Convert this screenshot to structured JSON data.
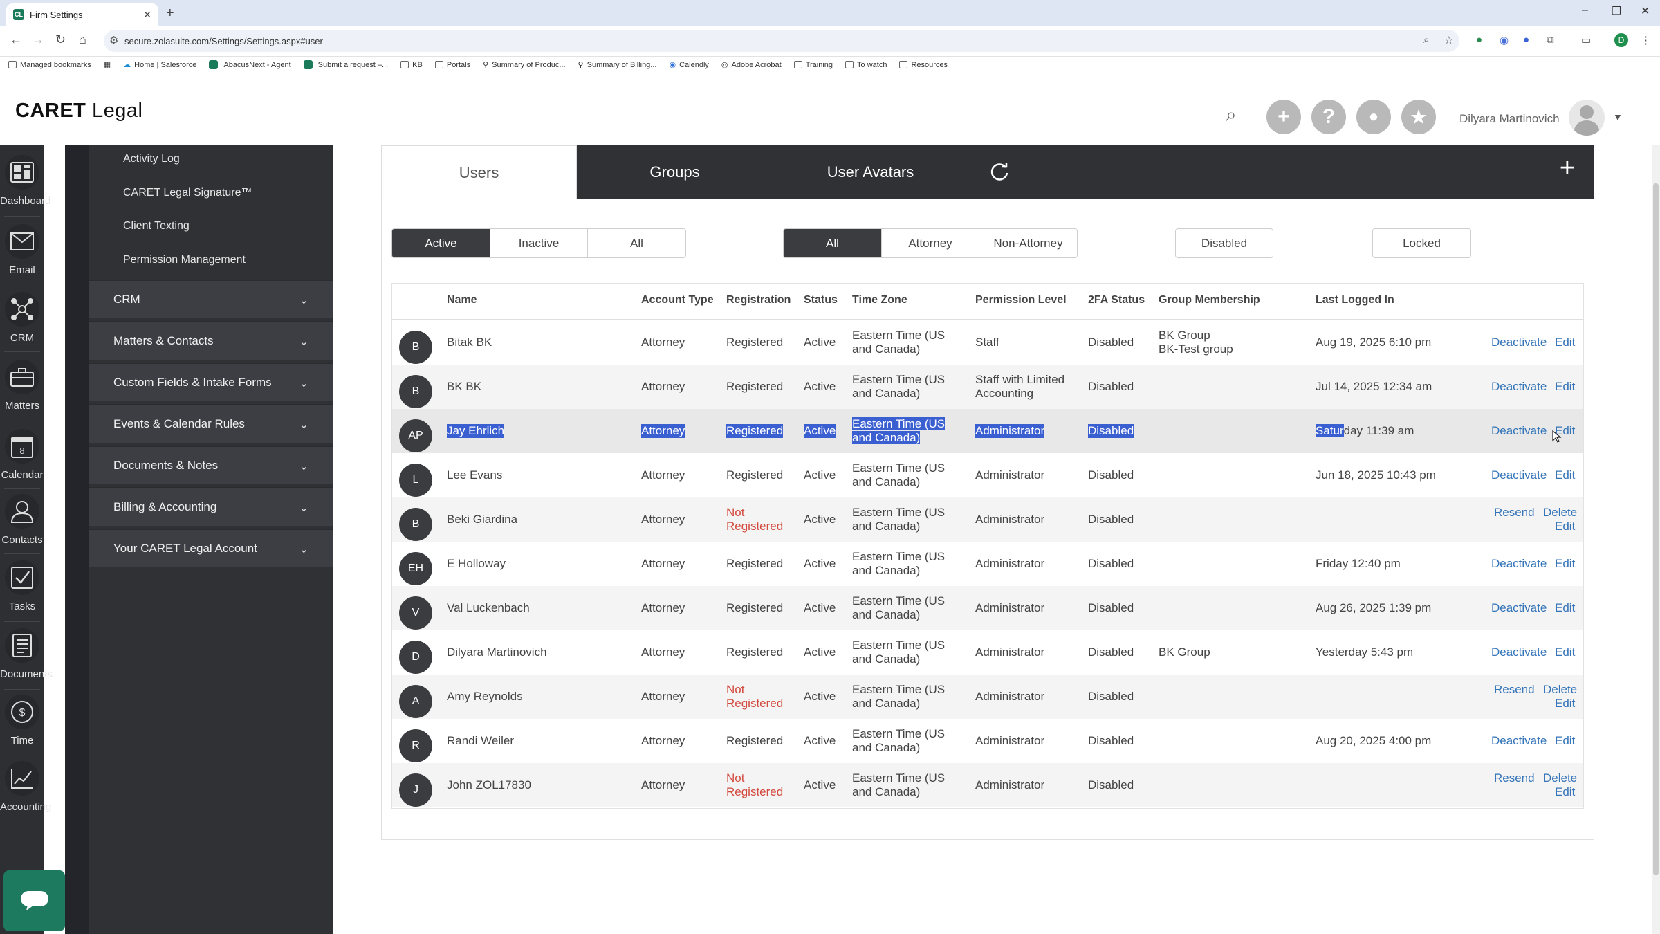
{
  "browser": {
    "tab_title": "Firm Settings",
    "favicon_text": "CL",
    "url": "secure.zolasuite.com/Settings/Settings.aspx#user",
    "profile_initial": "D",
    "bookmarks": [
      "Managed bookmarks",
      "Home | Salesforce",
      "AbacusNext - Agent",
      "Submit a request –...",
      "KB",
      "Portals",
      "Summary of Produc...",
      "Summary of Billing...",
      "Calendly",
      "Adobe Acrobat",
      "Training",
      "To watch",
      "Resources"
    ]
  },
  "header": {
    "logo_prefix": "CARET",
    "logo_suffix": " Legal",
    "user_name": "Dilyara Martinovich"
  },
  "rail": {
    "items": [
      "Dashboard",
      "Email",
      "CRM",
      "Matters",
      "Calendar",
      "Contacts",
      "Tasks",
      "Documents",
      "Time",
      "Accounting"
    ],
    "calendar_day": "8"
  },
  "settings_nav": {
    "sub_items": [
      "Activity Log",
      "CARET Legal Signature™",
      "Client Texting",
      "Permission Management"
    ],
    "sections": [
      "CRM",
      "Matters & Contacts",
      "Custom Fields & Intake Forms",
      "Events & Calendar Rules",
      "Documents & Notes",
      "Billing & Accounting",
      "Your CARET Legal Account"
    ]
  },
  "tabs": {
    "users": "Users",
    "groups": "Groups",
    "avatars": "User Avatars"
  },
  "filters": {
    "status": [
      "Active",
      "Inactive",
      "All"
    ],
    "type": [
      "All",
      "Attorney",
      "Non-Attorney"
    ],
    "disabled": "Disabled",
    "locked": "Locked"
  },
  "table": {
    "columns": [
      "Name",
      "Account Type",
      "Registration",
      "Status",
      "Time Zone",
      "Permission Level",
      "2FA Status",
      "Group Membership",
      "Last Logged In"
    ],
    "rows": [
      {
        "initials": "B",
        "name": "Bitak BK",
        "type": "Attorney",
        "reg": "Registered",
        "status": "Active",
        "tz1": "Eastern Time (US",
        "tz2": "and Canada)",
        "perm1": "Staff",
        "perm2": "",
        "twofa": "Disabled",
        "group1": "BK Group",
        "group2": "BK-Test group",
        "last": "Aug 19, 2025 6:10 pm",
        "act1": "Deactivate",
        "act2": "Edit"
      },
      {
        "initials": "B",
        "name": "BK BK",
        "type": "Attorney",
        "reg": "Registered",
        "status": "Active",
        "tz1": "Eastern Time (US",
        "tz2": "and Canada)",
        "perm1": "Staff with Limited",
        "perm2": "Accounting",
        "twofa": "Disabled",
        "group1": "",
        "group2": "",
        "last": "Jul 14, 2025 12:34 am",
        "act1": "Deactivate",
        "act2": "Edit"
      },
      {
        "initials": "AP",
        "name": "Jay Ehrlich",
        "type": "Attorney",
        "reg": "Registered",
        "status": "Active",
        "tz1": "Eastern Time (US",
        "tz2": "and Canada)",
        "perm1": "Administrator",
        "perm2": "",
        "twofa": "Disabled",
        "group1": "",
        "group2": "",
        "last_a": "Satur",
        "last_b": "day 11:39 am",
        "act1": "Deactivate",
        "act2": "Edit"
      },
      {
        "initials": "L",
        "name": "Lee Evans",
        "type": "Attorney",
        "reg": "Registered",
        "status": "Active",
        "tz1": "Eastern Time (US",
        "tz2": "and Canada)",
        "perm1": "Administrator",
        "perm2": "",
        "twofa": "Disabled",
        "group1": "",
        "group2": "",
        "last": "Jun 18, 2025 10:43 pm",
        "act1": "Deactivate",
        "act2": "Edit"
      },
      {
        "initials": "B",
        "name": "Beki Giardina",
        "type": "Attorney",
        "reg1": "Not",
        "reg2": "Registered",
        "status": "Active",
        "tz1": "Eastern Time (US",
        "tz2": "and Canada)",
        "perm1": "Administrator",
        "perm2": "",
        "twofa": "Disabled",
        "group1": "",
        "group2": "",
        "last": "",
        "act1": "Resend",
        "act2": "Delete",
        "act3": "Edit"
      },
      {
        "initials": "EH",
        "name": "E Holloway",
        "type": "Attorney",
        "reg": "Registered",
        "status": "Active",
        "tz1": "Eastern Time (US",
        "tz2": "and Canada)",
        "perm1": "Administrator",
        "perm2": "",
        "twofa": "Disabled",
        "group1": "",
        "group2": "",
        "last": "Friday 12:40 pm",
        "act1": "Deactivate",
        "act2": "Edit"
      },
      {
        "initials": "V",
        "name": "Val Luckenbach",
        "type": "Attorney",
        "reg": "Registered",
        "status": "Active",
        "tz1": "Eastern Time (US",
        "tz2": "and Canada)",
        "perm1": "Administrator",
        "perm2": "",
        "twofa": "Disabled",
        "group1": "",
        "group2": "",
        "last": "Aug 26, 2025 1:39 pm",
        "act1": "Deactivate",
        "act2": "Edit"
      },
      {
        "initials": "D",
        "name": "Dilyara Martinovich",
        "type": "Attorney",
        "reg": "Registered",
        "status": "Active",
        "tz1": "Eastern Time (US",
        "tz2": "and Canada)",
        "perm1": "Administrator",
        "perm2": "",
        "twofa": "Disabled",
        "group1": "BK Group",
        "group2": "",
        "last": "Yesterday 5:43 pm",
        "act1": "Deactivate",
        "act2": "Edit"
      },
      {
        "initials": "A",
        "name": "Amy Reynolds",
        "type": "Attorney",
        "reg1": "Not",
        "reg2": "Registered",
        "status": "Active",
        "tz1": "Eastern Time (US",
        "tz2": "and Canada)",
        "perm1": "Administrator",
        "perm2": "",
        "twofa": "Disabled",
        "group1": "",
        "group2": "",
        "last": "",
        "act1": "Resend",
        "act2": "Delete",
        "act3": "Edit"
      },
      {
        "initials": "R",
        "name": "Randi Weiler",
        "type": "Attorney",
        "reg": "Registered",
        "status": "Active",
        "tz1": "Eastern Time (US",
        "tz2": "and Canada)",
        "perm1": "Administrator",
        "perm2": "",
        "twofa": "Disabled",
        "group1": "",
        "group2": "",
        "last": "Aug 20, 2025 4:00 pm",
        "act1": "Deactivate",
        "act2": "Edit"
      },
      {
        "initials": "J",
        "name": "John ZOL17830",
        "type": "Attorney",
        "reg1": "Not",
        "reg2": "Registered",
        "status": "Active",
        "tz1": "Eastern Time (US",
        "tz2": "and Canada)",
        "perm1": "Administrator",
        "perm2": "",
        "twofa": "Disabled",
        "group1": "",
        "group2": "",
        "last": "",
        "act1": "Resend",
        "act2": "Delete",
        "act3": "Edit"
      }
    ]
  },
  "colors": {
    "accent_green": "#1d7a5e",
    "dark": "#2f3135",
    "selection": "#3a5fd1",
    "link": "#3474b8",
    "not_registered": "#d24a3e"
  }
}
